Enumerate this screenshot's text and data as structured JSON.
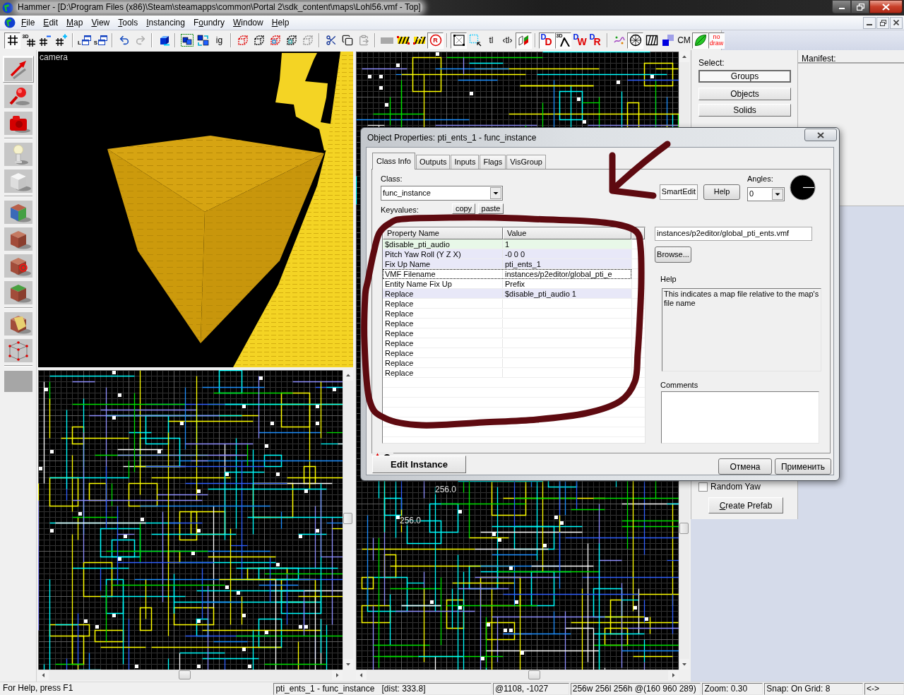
{
  "window": {
    "title": "Hammer - [D:\\Program Files (x86)\\Steam\\steamapps\\common\\Portal 2\\sdk_content\\maps\\Lohl56.vmf - Top]"
  },
  "menu_bar": {
    "items": [
      {
        "accel": "F",
        "post": "ile"
      },
      {
        "accel": "E",
        "post": "dit"
      },
      {
        "accel": "M",
        "post": "ap"
      },
      {
        "accel": "V",
        "post": "iew"
      },
      {
        "accel": "T",
        "post": "ools"
      },
      {
        "accel": "I",
        "post": "nstancing"
      },
      {
        "pre": "F",
        "accel": "o",
        "post": "undry"
      },
      {
        "accel": "W",
        "post": "indow"
      },
      {
        "accel": "H",
        "post": "elp"
      }
    ]
  },
  "toolbar": {
    "groups": [
      {
        "items": [
          {
            "kind": "grid",
            "pressed": true,
            "disabled": false
          },
          {
            "kind": "grid",
            "label": "3D",
            "pressed": false,
            "disabled": false
          },
          {
            "kind": "grid-minus",
            "pressed": false,
            "disabled": false
          },
          {
            "kind": "grid-plus",
            "pressed": false,
            "disabled": false
          }
        ]
      },
      {
        "items": [
          {
            "kind": "windows",
            "label": "L",
            "pressed": false,
            "disabled": false
          },
          {
            "kind": "windows",
            "label": "S",
            "pressed": false,
            "disabled": false
          }
        ]
      },
      {
        "items": [
          {
            "kind": "undo",
            "pressed": false,
            "disabled": false
          },
          {
            "kind": "redo",
            "pressed": false,
            "disabled": true
          }
        ]
      },
      {
        "items": [
          {
            "kind": "box",
            "pressed": false,
            "disabled": false
          }
        ]
      },
      {
        "items": [
          {
            "kind": "boxes",
            "pressed": false,
            "disabled": false
          },
          {
            "kind": "boxes-arrows",
            "pressed": false,
            "disabled": false
          },
          {
            "kind": "text",
            "label": "ig",
            "pressed": false,
            "disabled": false
          }
        ]
      },
      {
        "items": [
          {
            "kind": "dashed-cube-red",
            "pressed": false,
            "disabled": false
          },
          {
            "kind": "dashed-cube",
            "pressed": false,
            "disabled": false
          },
          {
            "kind": "dashed-cube-mark-red",
            "pressed": false,
            "disabled": false
          },
          {
            "kind": "dashed-cube-mark",
            "pressed": false,
            "disabled": false
          },
          {
            "kind": "dashed-cube",
            "pressed": false,
            "disabled": true
          }
        ]
      },
      {
        "items": [
          {
            "kind": "cut",
            "pressed": false,
            "disabled": false
          },
          {
            "kind": "copy",
            "pressed": false,
            "disabled": false
          },
          {
            "kind": "paste",
            "pressed": false,
            "disabled": true
          }
        ]
      },
      {
        "items": [
          {
            "kind": "bar",
            "pressed": false,
            "disabled": false
          },
          {
            "kind": "striped-bar",
            "pressed": false,
            "disabled": false
          },
          {
            "kind": "striped-bar-x",
            "pressed": false,
            "disabled": false
          },
          {
            "kind": "ring",
            "label": "R",
            "pressed": true,
            "disabled": false
          }
        ]
      },
      {
        "items": [
          {
            "kind": "square-x",
            "pressed": true,
            "disabled": false
          },
          {
            "kind": "dotted-square",
            "pressed": false,
            "disabled": false
          },
          {
            "kind": "text",
            "label": "tl",
            "pressed": false,
            "disabled": false
          },
          {
            "kind": "text",
            "label": "‹tl›",
            "pressed": false,
            "disabled": false
          },
          {
            "kind": "planes",
            "pressed": true,
            "disabled": false
          }
        ]
      },
      {
        "items": [
          {
            "kind": "letters",
            "letters": [
              "D",
              "D"
            ],
            "pressed": true,
            "disabled": false
          },
          {
            "kind": "peak",
            "label": "3D",
            "pressed": true,
            "disabled": false
          },
          {
            "kind": "letters",
            "letters": [
              "D",
              "W"
            ],
            "pressed": false,
            "disabled": false
          },
          {
            "kind": "letters",
            "letters": [
              "D",
              "R"
            ],
            "pressed": false,
            "disabled": false
          }
        ]
      },
      {
        "items": [
          {
            "kind": "scribble",
            "pressed": false,
            "disabled": false
          },
          {
            "kind": "sphere",
            "pressed": true,
            "disabled": false
          },
          {
            "kind": "striped-box",
            "pressed": false,
            "disabled": false
          },
          {
            "kind": "squares",
            "pressed": false,
            "disabled": false
          },
          {
            "kind": "text",
            "label": "CM",
            "pressed": false,
            "disabled": false
          },
          {
            "kind": "leaf",
            "pressed": true,
            "disabled": false
          },
          {
            "kind": "red-text",
            "label": "no draw",
            "pressed": true,
            "disabled": false
          }
        ]
      }
    ]
  },
  "tool_palette": {
    "groups": [
      {
        "tools": [
          {
            "kind": "arrow",
            "selected": true
          },
          {
            "kind": "magnifier",
            "selected": false
          },
          {
            "kind": "camera",
            "selected": false
          }
        ]
      },
      {
        "tools": [
          {
            "kind": "lightbulb",
            "selected": false
          },
          {
            "kind": "cube",
            "selected": false
          }
        ]
      },
      {
        "tools": [
          {
            "kind": "textured-cube",
            "selected": false
          },
          {
            "kind": "brick-cube",
            "selected": false
          },
          {
            "kind": "target-cube",
            "selected": false
          },
          {
            "kind": "grass-cube",
            "selected": false
          }
        ]
      },
      {
        "tools": [
          {
            "kind": "clipped-cube",
            "selected": false
          },
          {
            "kind": "wireframe-cube",
            "selected": false
          }
        ]
      },
      {
        "tools": [
          {
            "kind": "blank",
            "selected": false
          }
        ]
      }
    ]
  },
  "views": {
    "camera_label": "camera",
    "right_view_labels": [
      "256.0",
      "256.0"
    ]
  },
  "select_panel": {
    "label": "Select:",
    "buttons": [
      {
        "label": "Groups",
        "selected": true
      },
      {
        "label": "Objects",
        "selected": false
      },
      {
        "label": "Solids",
        "selected": false
      }
    ],
    "random_yaw": {
      "label": "Random Yaw",
      "checked": false
    },
    "create_prefab": {
      "accel": "C",
      "post": "reate Prefab"
    }
  },
  "manifest": {
    "title": "Manifest:"
  },
  "dialog": {
    "title": "Object Properties: pti_ents_1 - func_instance",
    "tabs": [
      {
        "label": "Class Info",
        "selected": true
      },
      {
        "label": "Outputs",
        "selected": false
      },
      {
        "label": "Inputs",
        "selected": false
      },
      {
        "label": "Flags",
        "selected": false
      },
      {
        "label": "VisGroup",
        "selected": false
      }
    ],
    "class": {
      "label": "Class:",
      "value": "func_instance"
    },
    "keyvalues": {
      "label": "Keyvalues:",
      "copy": "copy",
      "paste": "paste"
    },
    "smart_edit": {
      "label": "SmartEdit",
      "on": true
    },
    "help_button": "Help",
    "angles": {
      "label": "Angles:",
      "value": "0"
    },
    "table": {
      "columns": [
        "Property Name",
        "Value"
      ],
      "rows": [
        {
          "name": "$disable_pti_audio",
          "value": "1",
          "color": "#e8f8e8",
          "focused": false
        },
        {
          "name": "Pitch Yaw Roll (Y Z X)",
          "value": "-0 0 0",
          "color": "#e8e8f8",
          "focused": false
        },
        {
          "name": "Fix Up Name",
          "value": "pti_ents_1",
          "color": "#e8e8f8",
          "focused": false
        },
        {
          "name": "VMF Filename",
          "value": "instances/p2editor/global_pti_e",
          "color": "#ffffff",
          "focused": true
        },
        {
          "name": "Entity Name Fix Up",
          "value": "Prefix",
          "color": "#ffffff",
          "focused": false
        },
        {
          "name": "Replace",
          "value": "$disable_pti_audio 1",
          "color": "#e8e8f8",
          "focused": false
        },
        {
          "name": "Replace",
          "color": "#ffffff",
          "focused": false
        },
        {
          "name": "Replace",
          "color": "#ffffff",
          "focused": false
        },
        {
          "name": "Replace",
          "color": "#ffffff",
          "focused": false
        },
        {
          "name": "Replace",
          "color": "#ffffff",
          "focused": false
        },
        {
          "name": "Replace",
          "color": "#ffffff",
          "focused": false
        },
        {
          "name": "Replace",
          "color": "#ffffff",
          "focused": false
        },
        {
          "name": "Replace",
          "color": "#ffffff",
          "focused": false
        },
        {
          "name": "Replace",
          "color": "#ffffff",
          "focused": false
        }
      ]
    },
    "value_field": "instances/p2editor/global_pti_ents.vmf",
    "browse_button": "Browse...",
    "help": {
      "label": "Help",
      "text": "This indicates a map file relative to the map's file name"
    },
    "comments": {
      "label": "Comments"
    },
    "edit_instance_button": "Edit Instance",
    "buttons": [
      "Отмена",
      "Применить"
    ]
  },
  "status_bar": {
    "panes": [
      "For Help, press F1",
      "pti_ents_1 - func_instance   [dist: 333.8]",
      "@1108, -1027",
      "256w 256l 256h @(160 960 289)",
      "Zoom: 0.30",
      "Snap: On Grid: 8",
      "<->"
    ]
  }
}
